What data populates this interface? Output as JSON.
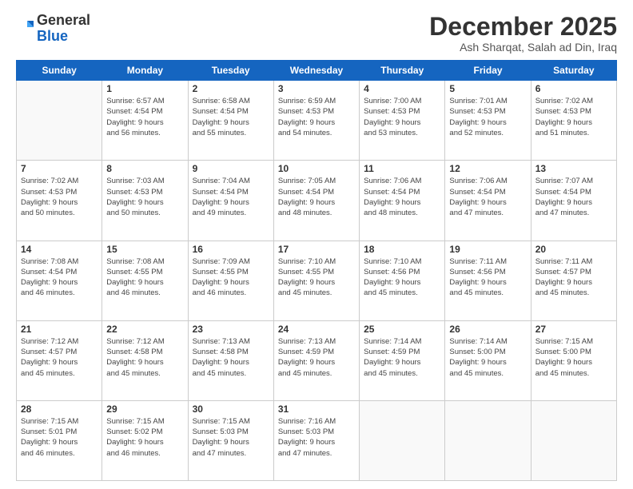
{
  "logo": {
    "general": "General",
    "blue": "Blue"
  },
  "header": {
    "title": "December 2025",
    "subtitle": "Ash Sharqat, Salah ad Din, Iraq"
  },
  "weekdays": [
    "Sunday",
    "Monday",
    "Tuesday",
    "Wednesday",
    "Thursday",
    "Friday",
    "Saturday"
  ],
  "weeks": [
    [
      {
        "day": "",
        "info": ""
      },
      {
        "day": "1",
        "info": "Sunrise: 6:57 AM\nSunset: 4:54 PM\nDaylight: 9 hours\nand 56 minutes."
      },
      {
        "day": "2",
        "info": "Sunrise: 6:58 AM\nSunset: 4:54 PM\nDaylight: 9 hours\nand 55 minutes."
      },
      {
        "day": "3",
        "info": "Sunrise: 6:59 AM\nSunset: 4:53 PM\nDaylight: 9 hours\nand 54 minutes."
      },
      {
        "day": "4",
        "info": "Sunrise: 7:00 AM\nSunset: 4:53 PM\nDaylight: 9 hours\nand 53 minutes."
      },
      {
        "day": "5",
        "info": "Sunrise: 7:01 AM\nSunset: 4:53 PM\nDaylight: 9 hours\nand 52 minutes."
      },
      {
        "day": "6",
        "info": "Sunrise: 7:02 AM\nSunset: 4:53 PM\nDaylight: 9 hours\nand 51 minutes."
      }
    ],
    [
      {
        "day": "7",
        "info": "Sunrise: 7:02 AM\nSunset: 4:53 PM\nDaylight: 9 hours\nand 50 minutes."
      },
      {
        "day": "8",
        "info": "Sunrise: 7:03 AM\nSunset: 4:53 PM\nDaylight: 9 hours\nand 50 minutes."
      },
      {
        "day": "9",
        "info": "Sunrise: 7:04 AM\nSunset: 4:54 PM\nDaylight: 9 hours\nand 49 minutes."
      },
      {
        "day": "10",
        "info": "Sunrise: 7:05 AM\nSunset: 4:54 PM\nDaylight: 9 hours\nand 48 minutes."
      },
      {
        "day": "11",
        "info": "Sunrise: 7:06 AM\nSunset: 4:54 PM\nDaylight: 9 hours\nand 48 minutes."
      },
      {
        "day": "12",
        "info": "Sunrise: 7:06 AM\nSunset: 4:54 PM\nDaylight: 9 hours\nand 47 minutes."
      },
      {
        "day": "13",
        "info": "Sunrise: 7:07 AM\nSunset: 4:54 PM\nDaylight: 9 hours\nand 47 minutes."
      }
    ],
    [
      {
        "day": "14",
        "info": "Sunrise: 7:08 AM\nSunset: 4:54 PM\nDaylight: 9 hours\nand 46 minutes."
      },
      {
        "day": "15",
        "info": "Sunrise: 7:08 AM\nSunset: 4:55 PM\nDaylight: 9 hours\nand 46 minutes."
      },
      {
        "day": "16",
        "info": "Sunrise: 7:09 AM\nSunset: 4:55 PM\nDaylight: 9 hours\nand 46 minutes."
      },
      {
        "day": "17",
        "info": "Sunrise: 7:10 AM\nSunset: 4:55 PM\nDaylight: 9 hours\nand 45 minutes."
      },
      {
        "day": "18",
        "info": "Sunrise: 7:10 AM\nSunset: 4:56 PM\nDaylight: 9 hours\nand 45 minutes."
      },
      {
        "day": "19",
        "info": "Sunrise: 7:11 AM\nSunset: 4:56 PM\nDaylight: 9 hours\nand 45 minutes."
      },
      {
        "day": "20",
        "info": "Sunrise: 7:11 AM\nSunset: 4:57 PM\nDaylight: 9 hours\nand 45 minutes."
      }
    ],
    [
      {
        "day": "21",
        "info": "Sunrise: 7:12 AM\nSunset: 4:57 PM\nDaylight: 9 hours\nand 45 minutes."
      },
      {
        "day": "22",
        "info": "Sunrise: 7:12 AM\nSunset: 4:58 PM\nDaylight: 9 hours\nand 45 minutes."
      },
      {
        "day": "23",
        "info": "Sunrise: 7:13 AM\nSunset: 4:58 PM\nDaylight: 9 hours\nand 45 minutes."
      },
      {
        "day": "24",
        "info": "Sunrise: 7:13 AM\nSunset: 4:59 PM\nDaylight: 9 hours\nand 45 minutes."
      },
      {
        "day": "25",
        "info": "Sunrise: 7:14 AM\nSunset: 4:59 PM\nDaylight: 9 hours\nand 45 minutes."
      },
      {
        "day": "26",
        "info": "Sunrise: 7:14 AM\nSunset: 5:00 PM\nDaylight: 9 hours\nand 45 minutes."
      },
      {
        "day": "27",
        "info": "Sunrise: 7:15 AM\nSunset: 5:00 PM\nDaylight: 9 hours\nand 45 minutes."
      }
    ],
    [
      {
        "day": "28",
        "info": "Sunrise: 7:15 AM\nSunset: 5:01 PM\nDaylight: 9 hours\nand 46 minutes."
      },
      {
        "day": "29",
        "info": "Sunrise: 7:15 AM\nSunset: 5:02 PM\nDaylight: 9 hours\nand 46 minutes."
      },
      {
        "day": "30",
        "info": "Sunrise: 7:15 AM\nSunset: 5:03 PM\nDaylight: 9 hours\nand 47 minutes."
      },
      {
        "day": "31",
        "info": "Sunrise: 7:16 AM\nSunset: 5:03 PM\nDaylight: 9 hours\nand 47 minutes."
      },
      {
        "day": "",
        "info": ""
      },
      {
        "day": "",
        "info": ""
      },
      {
        "day": "",
        "info": ""
      }
    ]
  ]
}
